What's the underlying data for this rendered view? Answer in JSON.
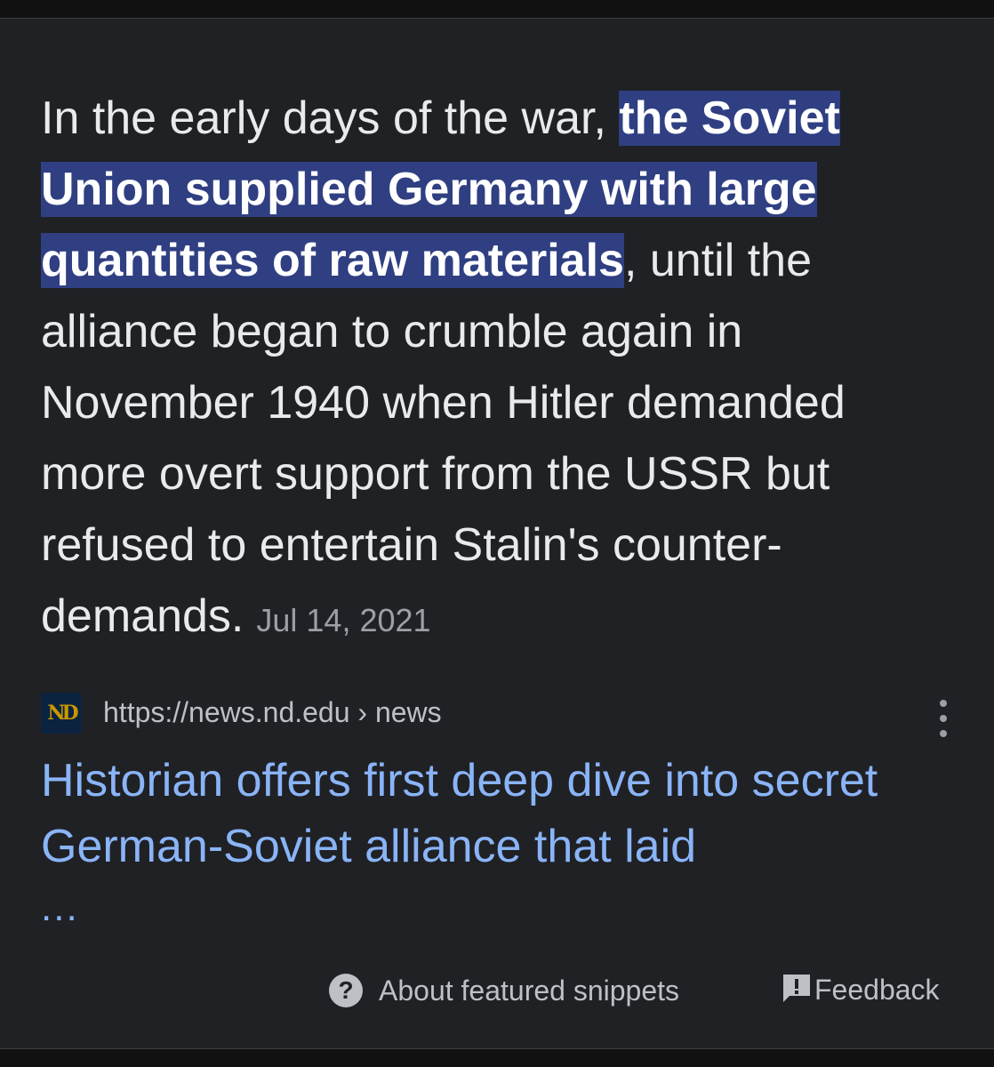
{
  "snippet": {
    "text_before": "In the early days of the war, ",
    "highlight": "the Soviet Union supplied Germany with large quantities of raw materials",
    "text_after": ", until the alliance began to crumble again in November 1940 when Hitler demanded more overt support from the USSR but refused to entertain Stalin's counter-demands.",
    "date": "Jul 14, 2021"
  },
  "source": {
    "favicon_icon": "notre-dame-logo-icon",
    "favicon_text": "ND",
    "url": "https://news.nd.edu",
    "breadcrumb": " › news",
    "more_icon": "more-vert-icon"
  },
  "result": {
    "title": "Historian offers first deep dive into secret German-Soviet alliance that laid",
    "ellipsis": "..."
  },
  "footer": {
    "about_icon": "help-circle-icon",
    "about_label": "About featured snippets",
    "feedback_icon": "feedback-icon",
    "feedback_label": "Feedback"
  },
  "colors": {
    "background": "#202124",
    "highlight_bg": "#2f3f82",
    "link": "#8ab4f8",
    "text": "#e8eaed",
    "muted": "#9aa0a6"
  }
}
